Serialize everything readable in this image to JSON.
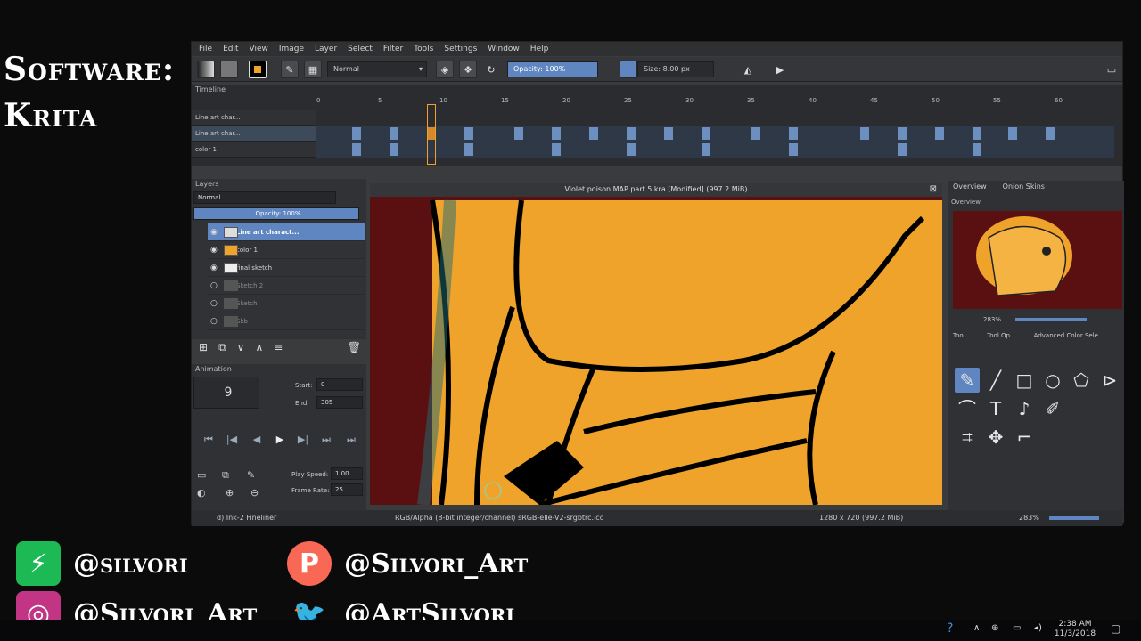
{
  "overlay": {
    "title_line1": "Software:",
    "title_line2": "Krita",
    "socials": [
      {
        "icon": "bolt-icon",
        "handle": "@silvori",
        "color": "#1db954"
      },
      {
        "icon": "patreon-icon",
        "handle": "@Silvori_Art",
        "color": "#f96854"
      },
      {
        "icon": "instagram-icon",
        "handle": "@Silvori_Art",
        "color": "#c13584"
      },
      {
        "icon": "twitter-icon",
        "handle": "@ArtSilvori",
        "color": "#1da1f2"
      }
    ]
  },
  "menu": [
    "File",
    "Edit",
    "View",
    "Image",
    "Layer",
    "Select",
    "Filter",
    "Tools",
    "Settings",
    "Window",
    "Help"
  ],
  "toolbar": {
    "blend_mode": "Normal",
    "opacity": "Opacity: 100%",
    "size": "Size: 8.00 px"
  },
  "timeline": {
    "title": "Timeline",
    "ruler": [
      "0",
      "5",
      "10",
      "15",
      "20",
      "25",
      "30",
      "35",
      "40",
      "45",
      "50",
      "55",
      "60"
    ],
    "rows": [
      "Line art char...",
      "Line art char...",
      "color 1"
    ]
  },
  "layers": {
    "title": "Layers",
    "blend": "Normal",
    "opacity": "Opacity: 100%",
    "items": [
      {
        "name": "Line art charact...",
        "state": "sel"
      },
      {
        "name": "color 1",
        "state": ""
      },
      {
        "name": "final sketch",
        "state": ""
      },
      {
        "name": "Sketch 2",
        "state": "dim"
      },
      {
        "name": "Sketch",
        "state": "dim"
      },
      {
        "name": "Skb",
        "state": "dim"
      }
    ]
  },
  "animation": {
    "title": "Animation",
    "current_frame": "9",
    "start_label": "Start:",
    "start_value": "0",
    "end_label": "End:",
    "end_value": "305",
    "play_speed_label": "Play Speed:",
    "play_speed_value": "1.00",
    "frame_rate_label": "Frame Rate:",
    "frame_rate_value": "25"
  },
  "document": {
    "title": "Violet poison MAP part 5.kra [Modified] (997.2 MiB)"
  },
  "right_panel": {
    "tabs": [
      "Overview",
      "Onion Skins"
    ],
    "overview_label": "Overview",
    "zoom": "283%",
    "sub_tabs": [
      "Too...",
      "Tool Op...",
      "Advanced Color Sele..."
    ]
  },
  "status": {
    "brush": "d) Ink-2 Fineliner",
    "color_space": "RGB/Alpha (8-bit integer/channel)  sRGB-elle-V2-srgbtrc.icc",
    "dimensions": "1280 x 720 (997.2 MiB)",
    "zoom": "283%"
  },
  "taskbar": {
    "time": "2:38 AM",
    "date": "11/3/2018"
  },
  "colors": {
    "canvas_bg": "#5a1010",
    "fill": "#f0a32a",
    "accent": "#5f86c0"
  }
}
